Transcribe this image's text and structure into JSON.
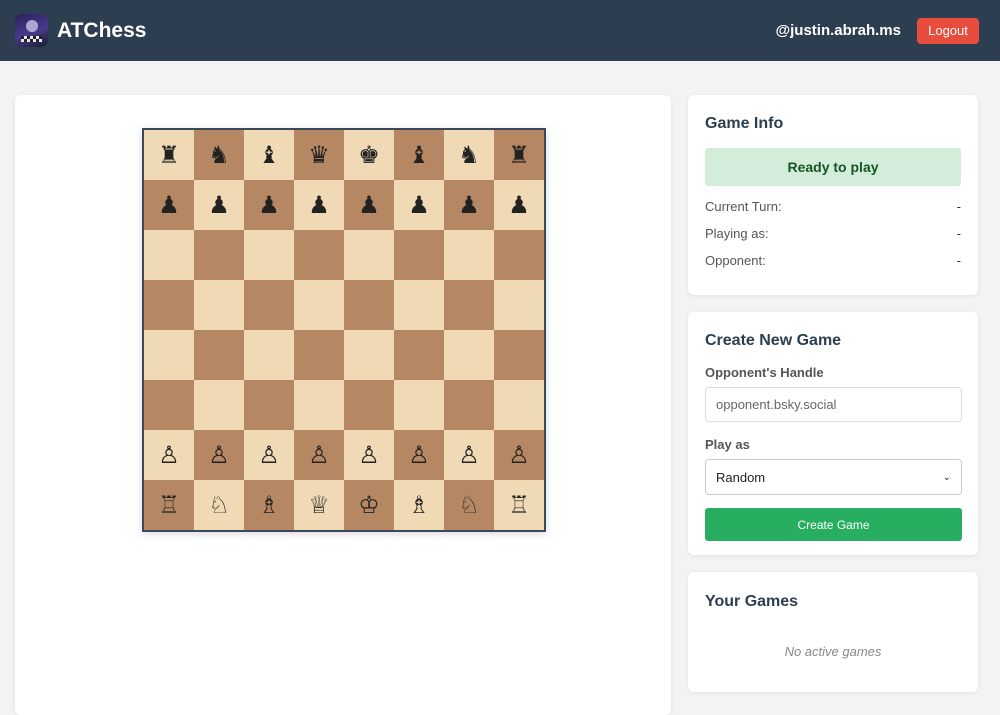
{
  "header": {
    "app_title": "ATChess",
    "username": "@justin.abrah.ms",
    "logout_label": "Logout"
  },
  "board": {
    "rows": [
      [
        "♜",
        "♞",
        "♝",
        "♛",
        "♚",
        "♝",
        "♞",
        "♜"
      ],
      [
        "♟",
        "♟",
        "♟",
        "♟",
        "♟",
        "♟",
        "♟",
        "♟"
      ],
      [
        "",
        "",
        "",
        "",
        "",
        "",
        "",
        ""
      ],
      [
        "",
        "",
        "",
        "",
        "",
        "",
        "",
        ""
      ],
      [
        "",
        "",
        "",
        "",
        "",
        "",
        "",
        ""
      ],
      [
        "",
        "",
        "",
        "",
        "",
        "",
        "",
        ""
      ],
      [
        "♙",
        "♙",
        "♙",
        "♙",
        "♙",
        "♙",
        "♙",
        "♙"
      ],
      [
        "♖",
        "♘",
        "♗",
        "♕",
        "♔",
        "♗",
        "♘",
        "♖"
      ]
    ]
  },
  "game_info": {
    "title": "Game Info",
    "status": "Ready to play",
    "rows": [
      {
        "label": "Current Turn:",
        "value": "-"
      },
      {
        "label": "Playing as:",
        "value": "-"
      },
      {
        "label": "Opponent:",
        "value": "-"
      }
    ]
  },
  "create_game": {
    "title": "Create New Game",
    "handle_label": "Opponent's Handle",
    "handle_placeholder": "opponent.bsky.social",
    "play_as_label": "Play as",
    "play_as_value": "Random",
    "button_label": "Create Game"
  },
  "your_games": {
    "title": "Your Games",
    "empty_text": "No active games"
  },
  "colors": {
    "header_bg": "#2d3e50",
    "logout_bg": "#e74c3c",
    "light_square": "#f0d9b5",
    "dark_square": "#b58863",
    "status_bg": "#d4edda",
    "create_bg": "#27ae60"
  }
}
